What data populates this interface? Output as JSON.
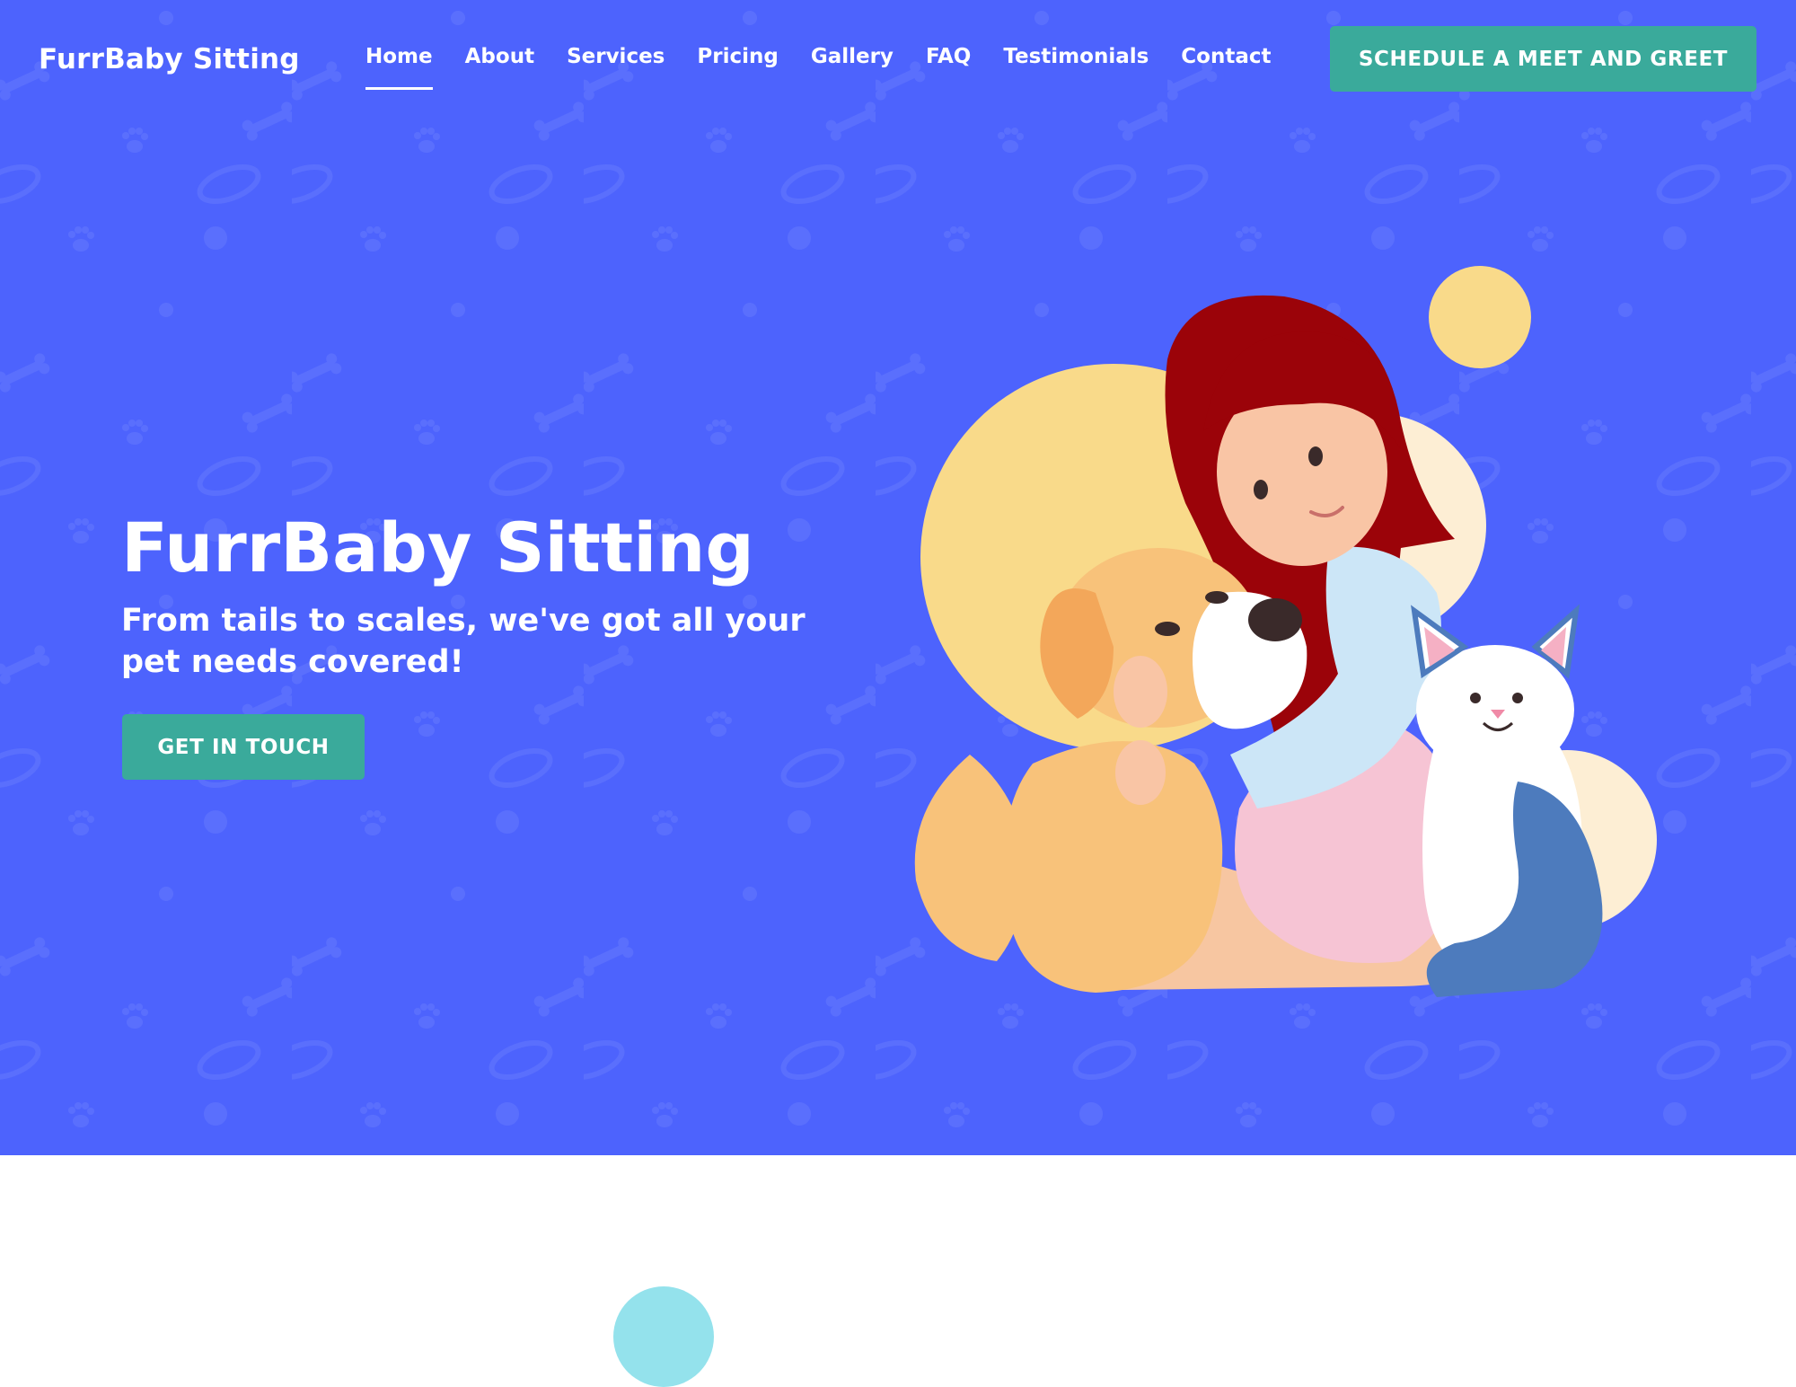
{
  "header": {
    "brand": "FurrBaby Sitting",
    "nav": [
      {
        "label": "Home",
        "active": true
      },
      {
        "label": "About"
      },
      {
        "label": "Services"
      },
      {
        "label": "Pricing"
      },
      {
        "label": "Gallery"
      },
      {
        "label": "FAQ"
      },
      {
        "label": "Testimonials"
      },
      {
        "label": "Contact"
      }
    ],
    "cta_label": "SCHEDULE A MEET AND GREET"
  },
  "hero": {
    "title": "FurrBaby Sitting",
    "subtitle": "From tails to scales, we've got all your pet needs covered!",
    "cta_label": "GET IN TOUCH",
    "illustration_icon": "woman-hugging-dog-and-cat-illustration"
  },
  "colors": {
    "hero_bg": "#4d63fd",
    "accent_button": "#3aaa9b",
    "text": "#ffffff",
    "circle_yellow": "#f9da8a",
    "circle_cream": "#fdeed4",
    "bottom_circle": "#94e2ec"
  }
}
